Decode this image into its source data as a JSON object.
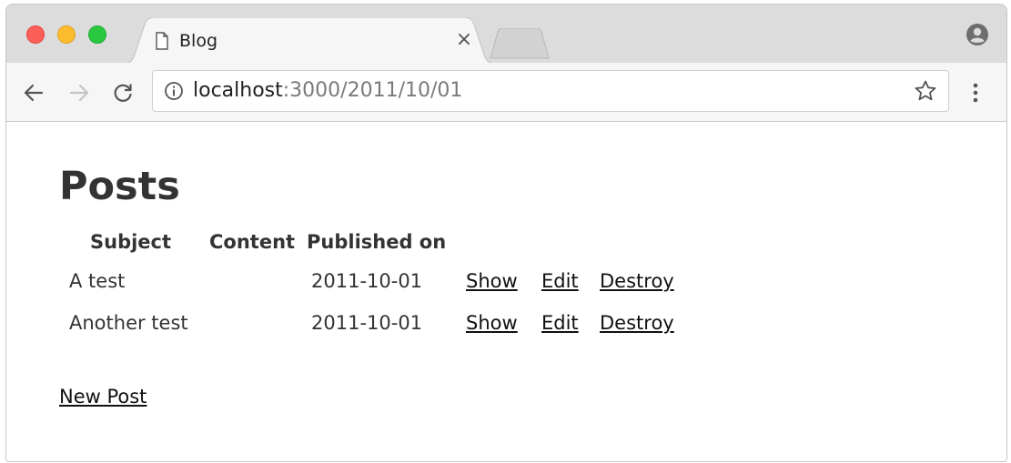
{
  "window": {
    "tab_title": "Blog",
    "tab_close": "×"
  },
  "toolbar": {
    "url_host": "localhost",
    "url_path": ":3000/2011/10/01"
  },
  "page": {
    "title": "Posts",
    "columns": [
      "Subject",
      "Content",
      "Published on"
    ],
    "rows": [
      {
        "subject": "A test",
        "content": "",
        "published_on": "2011-10-01",
        "show": "Show",
        "edit": "Edit",
        "destroy": "Destroy"
      },
      {
        "subject": "Another test",
        "content": "",
        "published_on": "2011-10-01",
        "show": "Show",
        "edit": "Edit",
        "destroy": "Destroy"
      }
    ],
    "new_post_label": "New Post"
  },
  "icons": [
    "close-window-icon",
    "minimize-window-icon",
    "maximize-window-icon",
    "page-icon",
    "tab-close-icon",
    "new-tab-icon",
    "profile-icon",
    "back-arrow-icon",
    "forward-arrow-icon",
    "reload-icon",
    "info-icon",
    "star-icon",
    "menu-icon"
  ],
  "colors": {
    "close": "#fc5f57",
    "minimize": "#fdbc2e",
    "maximize": "#29c840",
    "text": "#333333"
  }
}
